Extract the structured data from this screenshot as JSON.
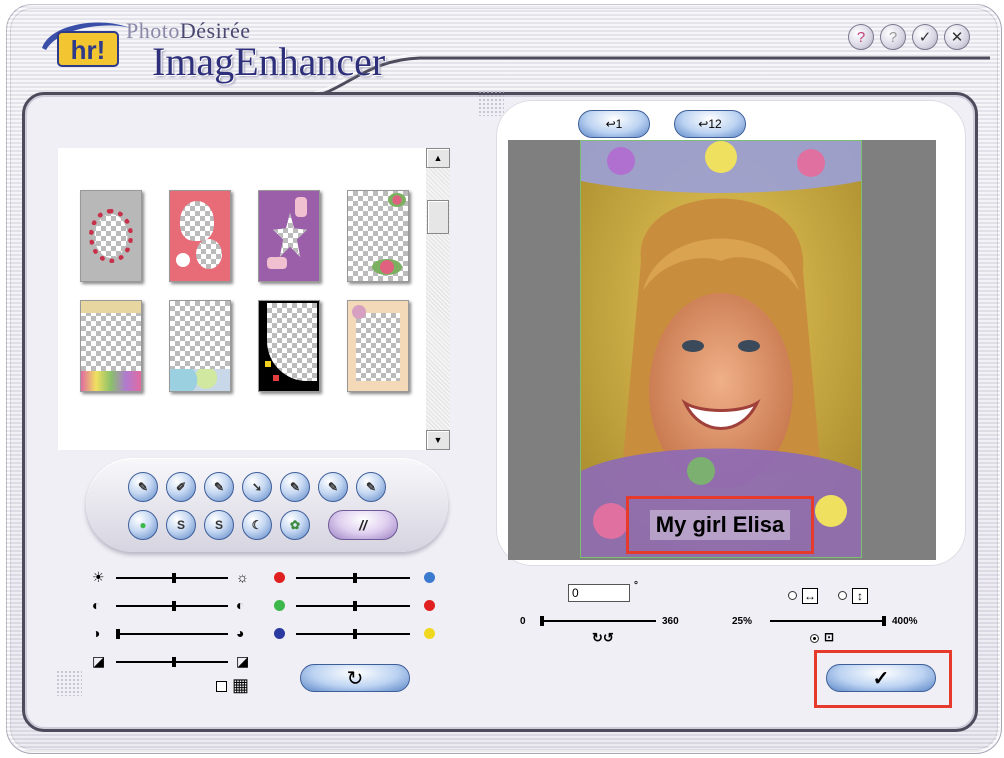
{
  "app": {
    "brand_prefix": "Photo",
    "brand_accent": "Désirée",
    "brand_main": "ImagEnhancer",
    "logo_text": "hr!"
  },
  "title_buttons": [
    {
      "name": "help-menu-button",
      "icon": "help-cursor-icon",
      "glyph": "?"
    },
    {
      "name": "help-button",
      "icon": "question-icon",
      "glyph": "?"
    },
    {
      "name": "confirm-window-button",
      "icon": "check-icon",
      "glyph": "✓"
    },
    {
      "name": "close-window-button",
      "icon": "close-icon",
      "glyph": "✕"
    }
  ],
  "thumbnails": [
    {
      "name": "frame-roses-oval"
    },
    {
      "name": "frame-pink-hearts"
    },
    {
      "name": "frame-purple-fairy"
    },
    {
      "name": "frame-corner-flowers"
    },
    {
      "name": "frame-bottom-flowers"
    },
    {
      "name": "frame-bottom-bubbles"
    },
    {
      "name": "frame-black-stars"
    },
    {
      "name": "frame-peach-border"
    }
  ],
  "scrollbar": {
    "up_glyph": "▲",
    "down_glyph": "▼"
  },
  "tools_row1": [
    "✎",
    "✐",
    "✎",
    "➘",
    "✎",
    "✎",
    "✎"
  ],
  "tools_row2": [
    "●",
    "S",
    "S",
    "☾",
    "✿"
  ],
  "wide_tool_label": "//",
  "adjust": {
    "brightness_left_icon": "☀",
    "brightness_right_icon": "☼",
    "contrast_left_icon": "◐",
    "contrast_right_icon": "◐",
    "saturation_left_icon": "◑",
    "saturation_right_icon": "◕",
    "gamma_left_icon": "◪",
    "gamma_right_icon": "◪",
    "grid_icon": "▦",
    "reset_glyph": "↻"
  },
  "colors": {
    "red": "#e02020",
    "blue": "#3c7ad0",
    "green": "#3cb84a",
    "navy": "#2a3aa0",
    "yellow": "#f0d820",
    "highlight": "#e53a2c"
  },
  "preview": {
    "prev_button_glyph": "↩1",
    "multi_button_glyph": "↩12",
    "caption": "My girl Elisa"
  },
  "rotation": {
    "value": "0",
    "degree_sign": "°",
    "min_label": "0",
    "max_label": "360",
    "rotate_glyph": "↻↺"
  },
  "zoom": {
    "min_label": "25%",
    "max_label": "400%",
    "fit_width_glyph": "↔",
    "fit_height_glyph": "↕",
    "fit_page_glyph": "⊡"
  },
  "ok_glyph": "✓"
}
